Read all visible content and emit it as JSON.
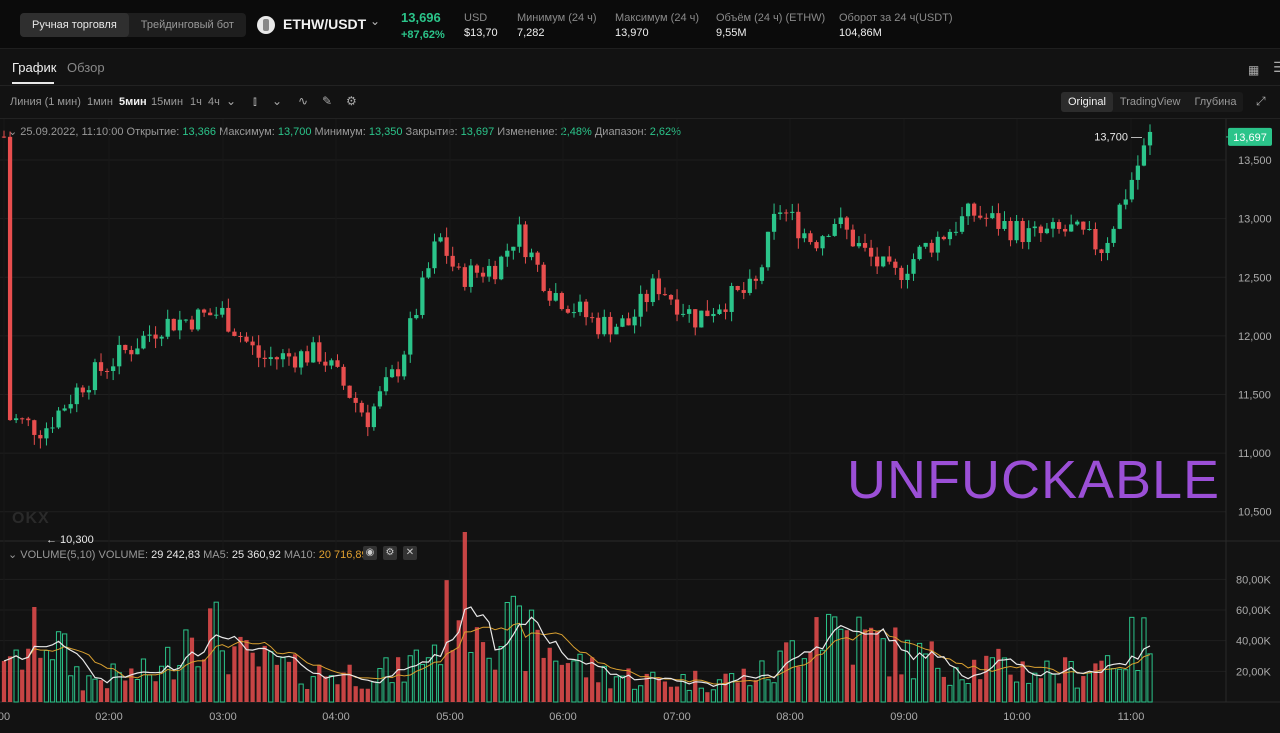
{
  "header": {
    "modes": [
      {
        "label": "Ручная торговля",
        "active": true
      },
      {
        "label": "Трейдинговый бот",
        "active": false
      }
    ],
    "pair": "ETHW/USDT",
    "price": "13,696",
    "change": "+87,62%",
    "stats": [
      {
        "label": "USD",
        "value": "$13,70"
      },
      {
        "label": "Минимум (24 ч)",
        "value": "7,282"
      },
      {
        "label": "Максимум (24 ч)",
        "value": "13,970"
      },
      {
        "label": "Объём (24 ч) (ETHW)",
        "value": "9,55M"
      },
      {
        "label": "Оборот за 24 ч(USDT)",
        "value": "104,86M"
      }
    ]
  },
  "tabs": [
    {
      "label": "График",
      "active": true
    },
    {
      "label": "Обзор",
      "active": false
    }
  ],
  "toolbar": {
    "timeframes": [
      {
        "label": "Линия (1 мин)",
        "active": false
      },
      {
        "label": "1мин",
        "active": false
      },
      {
        "label": "5мин",
        "active": true
      },
      {
        "label": "15мин",
        "active": false
      },
      {
        "label": "1ч",
        "active": false
      },
      {
        "label": "4ч",
        "active": false
      }
    ],
    "views": [
      {
        "label": "Original",
        "active": true
      },
      {
        "label": "TradingView",
        "active": false
      },
      {
        "label": "Глубина",
        "active": false
      }
    ]
  },
  "ohlc": {
    "time": "25.09.2022, 11:10:00",
    "open_label": "Открытие:",
    "open": "13,366",
    "high_label": "Максимум:",
    "high": "13,700",
    "low_label": "Минимум:",
    "low": "13,350",
    "close_label": "Закрытие:",
    "close": "13,697",
    "change_label": "Изменение:",
    "change": "2,48%",
    "range_label": "Диапазон:",
    "range": "2,62%"
  },
  "volume_header": {
    "name": "VOLUME(5,10)",
    "vol_label": "VOLUME:",
    "vol": "29 242,83",
    "ma5_label": "MA5:",
    "ma5": "25 360,92",
    "ma10_label": "MA10:",
    "ma10": "20 716,89"
  },
  "watermark": "UNFUCKABLE",
  "colors": {
    "up": "#2bc48a",
    "down": "#e84e4e",
    "ma5": "#e8e8e8",
    "ma10": "#d9a030",
    "bg": "#121212",
    "grid": "#1f1f1f"
  },
  "chart_data": {
    "type": "candlestick",
    "price_axis": {
      "ticks": [
        "13,500",
        "13,000",
        "12,500",
        "12,000",
        "11,500",
        "11,000",
        "10,500"
      ],
      "min": 10250,
      "max": 13850
    },
    "volume_axis": {
      "ticks": [
        "80,00K",
        "60,00K",
        "40,00K",
        "20,00K"
      ],
      "min": 0,
      "max": 90000
    },
    "time_ticks": [
      "00",
      "02:00",
      "03:00",
      "04:00",
      "05:00",
      "06:00",
      "07:00",
      "08:00",
      "09:00",
      "10:00",
      "11:00"
    ],
    "last_price_tag": "13,697",
    "high_marker": "13,700",
    "low_marker": "10,300",
    "series": [
      {
        "name": "candles",
        "values": []
      },
      {
        "name": "MA5",
        "values": []
      },
      {
        "name": "MA10",
        "values": []
      }
    ]
  },
  "kpoints": [
    [
      1,
      11300
    ],
    [
      10,
      11200
    ],
    [
      20,
      11600
    ],
    [
      40,
      12100
    ],
    [
      55,
      12200
    ],
    [
      65,
      11800
    ],
    [
      80,
      11850
    ],
    [
      92,
      11300
    ],
    [
      100,
      11750
    ],
    [
      110,
      12850
    ],
    [
      115,
      12500
    ],
    [
      125,
      12600
    ],
    [
      130,
      12900
    ],
    [
      138,
      12400
    ],
    [
      150,
      12100
    ],
    [
      158,
      12100
    ],
    [
      165,
      12450
    ],
    [
      175,
      12150
    ],
    [
      182,
      12300
    ],
    [
      190,
      12400
    ],
    [
      196,
      13100
    ],
    [
      205,
      12800
    ],
    [
      210,
      13000
    ],
    [
      218,
      12700
    ],
    [
      225,
      12500
    ],
    [
      233,
      12750
    ],
    [
      245,
      13050
    ],
    [
      260,
      12850
    ],
    [
      270,
      12900
    ],
    [
      278,
      12750
    ],
    [
      290,
      13700
    ]
  ],
  "vpoints": [
    [
      1,
      20000
    ],
    [
      10,
      50000
    ],
    [
      20,
      15000
    ],
    [
      40,
      20000
    ],
    [
      48,
      60000
    ],
    [
      60,
      30000
    ],
    [
      75,
      20000
    ],
    [
      100,
      20000
    ],
    [
      110,
      40000
    ],
    [
      115,
      80000
    ],
    [
      125,
      50000
    ],
    [
      135,
      40000
    ],
    [
      150,
      20000
    ],
    [
      165,
      15000
    ],
    [
      180,
      15000
    ],
    [
      195,
      20000
    ],
    [
      205,
      60000
    ],
    [
      215,
      45000
    ],
    [
      230,
      30000
    ],
    [
      245,
      25000
    ],
    [
      270,
      20000
    ],
    [
      288,
      40000
    ]
  ]
}
